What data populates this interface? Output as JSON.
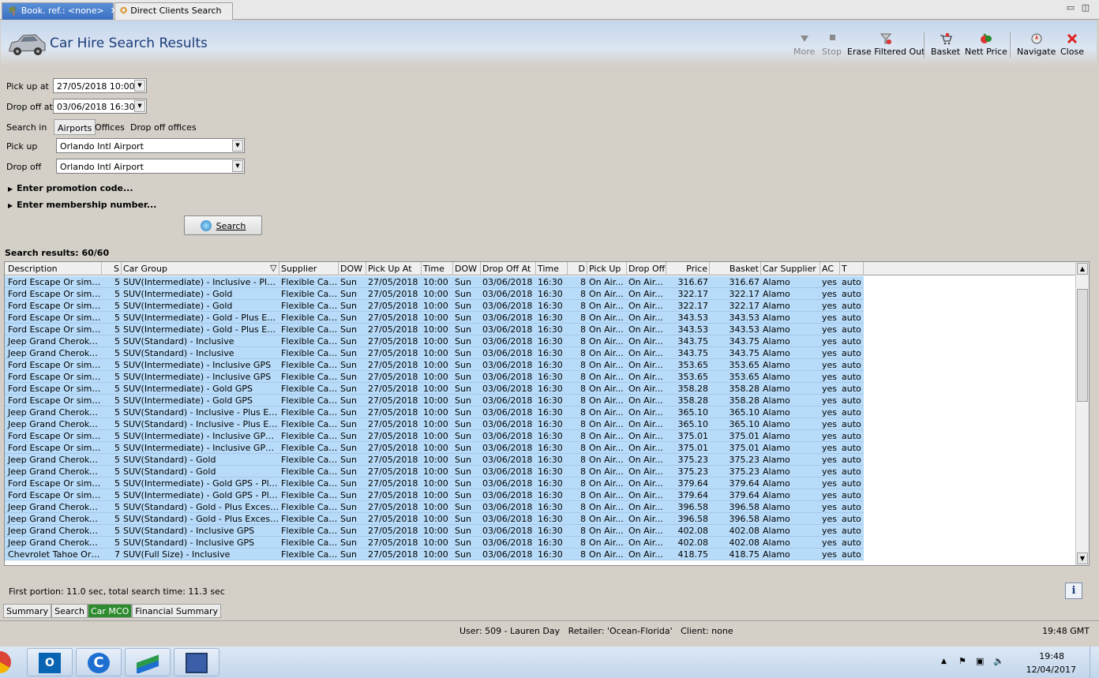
{
  "tabs": [
    {
      "label": "Book. ref.: <none>",
      "icon": "palm-tree-icon"
    },
    {
      "label": "Direct Clients Search",
      "icon": "star-person-icon"
    }
  ],
  "header": {
    "title": "Car Hire Search Results"
  },
  "toolbar": {
    "more": "More",
    "stop": "Stop",
    "erase_filtered_out": "Erase Filtered Out",
    "basket": "Basket",
    "nett_price": "Nett Price",
    "navigate": "Navigate",
    "close": "Close"
  },
  "form": {
    "pickup_at_label": "Pick up at",
    "pickup_at_value": "27/05/2018 10:00",
    "dropoff_at_label": "Drop off at",
    "dropoff_at_value": "03/06/2018 16:30",
    "search_in_label": "Search in",
    "search_in_options": [
      "Airports",
      "Offices",
      "Drop off offices"
    ],
    "search_in_selected": "Airports",
    "pickup_label": "Pick up",
    "pickup_value": "Orlando Intl Airport",
    "dropoff_label": "Drop off",
    "dropoff_value": "Orlando Intl Airport",
    "promo_label": "Enter promotion code...",
    "membership_label": "Enter membership number...",
    "search_button": "Search"
  },
  "results": {
    "title": "Search results: 60/60",
    "columns": [
      "Description",
      "S",
      "Car Group",
      "Supplier",
      "DOW",
      "Pick Up At",
      "Time",
      "DOW",
      "Drop Off At",
      "Time",
      "D",
      "Pick Up",
      "Drop Off",
      "Price",
      "Basket",
      "Car Supplier",
      "AC",
      "T"
    ],
    "rows": [
      [
        "Ford Escape Or simila...",
        "5",
        "SUV(Intermediate) - Inclusive - Plus E...",
        "Flexible Car...",
        "Sun",
        "27/05/2018",
        "10:00",
        "Sun",
        "03/06/2018",
        "16:30",
        "8",
        "On Air...",
        "On Air...",
        "316.67",
        "316.67",
        "Alamo",
        "yes",
        "auto"
      ],
      [
        "Ford Escape Or simila...",
        "5",
        "SUV(Intermediate) - Gold",
        "Flexible Car...",
        "Sun",
        "27/05/2018",
        "10:00",
        "Sun",
        "03/06/2018",
        "16:30",
        "8",
        "On Air...",
        "On Air...",
        "322.17",
        "322.17",
        "Alamo",
        "yes",
        "auto"
      ],
      [
        "Ford Escape Or simila...",
        "5",
        "SUV(Intermediate) - Gold",
        "Flexible Car...",
        "Sun",
        "27/05/2018",
        "10:00",
        "Sun",
        "03/06/2018",
        "16:30",
        "8",
        "On Air...",
        "On Air...",
        "322.17",
        "322.17",
        "Alamo",
        "yes",
        "auto"
      ],
      [
        "Ford Escape Or simila...",
        "5",
        "SUV(Intermediate) - Gold - Plus Exces...",
        "Flexible Car...",
        "Sun",
        "27/05/2018",
        "10:00",
        "Sun",
        "03/06/2018",
        "16:30",
        "8",
        "On Air...",
        "On Air...",
        "343.53",
        "343.53",
        "Alamo",
        "yes",
        "auto"
      ],
      [
        "Ford Escape Or simila...",
        "5",
        "SUV(Intermediate) - Gold - Plus Exces...",
        "Flexible Car...",
        "Sun",
        "27/05/2018",
        "10:00",
        "Sun",
        "03/06/2018",
        "16:30",
        "8",
        "On Air...",
        "On Air...",
        "343.53",
        "343.53",
        "Alamo",
        "yes",
        "auto"
      ],
      [
        "Jeep Grand Cheroke...",
        "5",
        "SUV(Standard) - Inclusive",
        "Flexible Car...",
        "Sun",
        "27/05/2018",
        "10:00",
        "Sun",
        "03/06/2018",
        "16:30",
        "8",
        "On Air...",
        "On Air...",
        "343.75",
        "343.75",
        "Alamo",
        "yes",
        "auto"
      ],
      [
        "Jeep Grand Cheroke...",
        "5",
        "SUV(Standard) - Inclusive",
        "Flexible Car...",
        "Sun",
        "27/05/2018",
        "10:00",
        "Sun",
        "03/06/2018",
        "16:30",
        "8",
        "On Air...",
        "On Air...",
        "343.75",
        "343.75",
        "Alamo",
        "yes",
        "auto"
      ],
      [
        "Ford Escape Or simila...",
        "5",
        "SUV(Intermediate) - Inclusive GPS",
        "Flexible Car...",
        "Sun",
        "27/05/2018",
        "10:00",
        "Sun",
        "03/06/2018",
        "16:30",
        "8",
        "On Air...",
        "On Air...",
        "353.65",
        "353.65",
        "Alamo",
        "yes",
        "auto"
      ],
      [
        "Ford Escape Or simila...",
        "5",
        "SUV(Intermediate) - Inclusive GPS",
        "Flexible Car...",
        "Sun",
        "27/05/2018",
        "10:00",
        "Sun",
        "03/06/2018",
        "16:30",
        "8",
        "On Air...",
        "On Air...",
        "353.65",
        "353.65",
        "Alamo",
        "yes",
        "auto"
      ],
      [
        "Ford Escape Or simila...",
        "5",
        "SUV(Intermediate) - Gold GPS",
        "Flexible Car...",
        "Sun",
        "27/05/2018",
        "10:00",
        "Sun",
        "03/06/2018",
        "16:30",
        "8",
        "On Air...",
        "On Air...",
        "358.28",
        "358.28",
        "Alamo",
        "yes",
        "auto"
      ],
      [
        "Ford Escape Or simila...",
        "5",
        "SUV(Intermediate) - Gold GPS",
        "Flexible Car...",
        "Sun",
        "27/05/2018",
        "10:00",
        "Sun",
        "03/06/2018",
        "16:30",
        "8",
        "On Air...",
        "On Air...",
        "358.28",
        "358.28",
        "Alamo",
        "yes",
        "auto"
      ],
      [
        "Jeep Grand Cheroke...",
        "5",
        "SUV(Standard) - Inclusive - Plus Exce...",
        "Flexible Car...",
        "Sun",
        "27/05/2018",
        "10:00",
        "Sun",
        "03/06/2018",
        "16:30",
        "8",
        "On Air...",
        "On Air...",
        "365.10",
        "365.10",
        "Alamo",
        "yes",
        "auto"
      ],
      [
        "Jeep Grand Cheroke...",
        "5",
        "SUV(Standard) - Inclusive - Plus Exce...",
        "Flexible Car...",
        "Sun",
        "27/05/2018",
        "10:00",
        "Sun",
        "03/06/2018",
        "16:30",
        "8",
        "On Air...",
        "On Air...",
        "365.10",
        "365.10",
        "Alamo",
        "yes",
        "auto"
      ],
      [
        "Ford Escape Or simila...",
        "5",
        "SUV(Intermediate) - Inclusive GPS - Pl...",
        "Flexible Car...",
        "Sun",
        "27/05/2018",
        "10:00",
        "Sun",
        "03/06/2018",
        "16:30",
        "8",
        "On Air...",
        "On Air...",
        "375.01",
        "375.01",
        "Alamo",
        "yes",
        "auto"
      ],
      [
        "Ford Escape Or simila...",
        "5",
        "SUV(Intermediate) - Inclusive GPS - Pl...",
        "Flexible Car...",
        "Sun",
        "27/05/2018",
        "10:00",
        "Sun",
        "03/06/2018",
        "16:30",
        "8",
        "On Air...",
        "On Air...",
        "375.01",
        "375.01",
        "Alamo",
        "yes",
        "auto"
      ],
      [
        "Jeep Grand Cheroke...",
        "5",
        "SUV(Standard) - Gold",
        "Flexible Car...",
        "Sun",
        "27/05/2018",
        "10:00",
        "Sun",
        "03/06/2018",
        "16:30",
        "8",
        "On Air...",
        "On Air...",
        "375.23",
        "375.23",
        "Alamo",
        "yes",
        "auto"
      ],
      [
        "Jeep Grand Cheroke...",
        "5",
        "SUV(Standard) - Gold",
        "Flexible Car...",
        "Sun",
        "27/05/2018",
        "10:00",
        "Sun",
        "03/06/2018",
        "16:30",
        "8",
        "On Air...",
        "On Air...",
        "375.23",
        "375.23",
        "Alamo",
        "yes",
        "auto"
      ],
      [
        "Ford Escape Or simila...",
        "5",
        "SUV(Intermediate) - Gold GPS - Plus E...",
        "Flexible Car...",
        "Sun",
        "27/05/2018",
        "10:00",
        "Sun",
        "03/06/2018",
        "16:30",
        "8",
        "On Air...",
        "On Air...",
        "379.64",
        "379.64",
        "Alamo",
        "yes",
        "auto"
      ],
      [
        "Ford Escape Or simila...",
        "5",
        "SUV(Intermediate) - Gold GPS - Plus E...",
        "Flexible Car...",
        "Sun",
        "27/05/2018",
        "10:00",
        "Sun",
        "03/06/2018",
        "16:30",
        "8",
        "On Air...",
        "On Air...",
        "379.64",
        "379.64",
        "Alamo",
        "yes",
        "auto"
      ],
      [
        "Jeep Grand Cheroke...",
        "5",
        "SUV(Standard) - Gold - Plus Excess R...",
        "Flexible Car...",
        "Sun",
        "27/05/2018",
        "10:00",
        "Sun",
        "03/06/2018",
        "16:30",
        "8",
        "On Air...",
        "On Air...",
        "396.58",
        "396.58",
        "Alamo",
        "yes",
        "auto"
      ],
      [
        "Jeep Grand Cheroke...",
        "5",
        "SUV(Standard) - Gold - Plus Excess R...",
        "Flexible Car...",
        "Sun",
        "27/05/2018",
        "10:00",
        "Sun",
        "03/06/2018",
        "16:30",
        "8",
        "On Air...",
        "On Air...",
        "396.58",
        "396.58",
        "Alamo",
        "yes",
        "auto"
      ],
      [
        "Jeep Grand Cheroke...",
        "5",
        "SUV(Standard) - Inclusive GPS",
        "Flexible Car...",
        "Sun",
        "27/05/2018",
        "10:00",
        "Sun",
        "03/06/2018",
        "16:30",
        "8",
        "On Air...",
        "On Air...",
        "402.08",
        "402.08",
        "Alamo",
        "yes",
        "auto"
      ],
      [
        "Jeep Grand Cheroke...",
        "5",
        "SUV(Standard) - Inclusive GPS",
        "Flexible Car...",
        "Sun",
        "27/05/2018",
        "10:00",
        "Sun",
        "03/06/2018",
        "16:30",
        "8",
        "On Air...",
        "On Air...",
        "402.08",
        "402.08",
        "Alamo",
        "yes",
        "auto"
      ],
      [
        "Chevrolet Tahoe Or ...",
        "7",
        "SUV(Full Size) - Inclusive",
        "Flexible Car...",
        "Sun",
        "27/05/2018",
        "10:00",
        "Sun",
        "03/06/2018",
        "16:30",
        "8",
        "On Air...",
        "On Air...",
        "418.75",
        "418.75",
        "Alamo",
        "yes",
        "auto"
      ]
    ]
  },
  "footer": {
    "timing": "First portion: 11.0 sec, total search time: 11.3 sec",
    "info": "i"
  },
  "bottom_tabs": [
    "Summary",
    "Search",
    "Car MCO",
    "Financial Summary"
  ],
  "bottom_tabs_active": "Car MCO",
  "status": {
    "text": "User: 509 - Lauren Day   Retailer: 'Ocean-Florida'   Client: none",
    "time": "19:48 GMT"
  },
  "taskbar": {
    "apps": [
      "chrome-icon",
      "outlook-icon",
      "app-c-icon",
      "app-layers-icon",
      "remote-desktop-icon"
    ],
    "clock_time": "19:48",
    "clock_date": "12/04/2017"
  },
  "colors": {
    "row_selected": "#b7dbf8",
    "active_tab": "#2e8b2e",
    "title": "#1b3d7a"
  }
}
